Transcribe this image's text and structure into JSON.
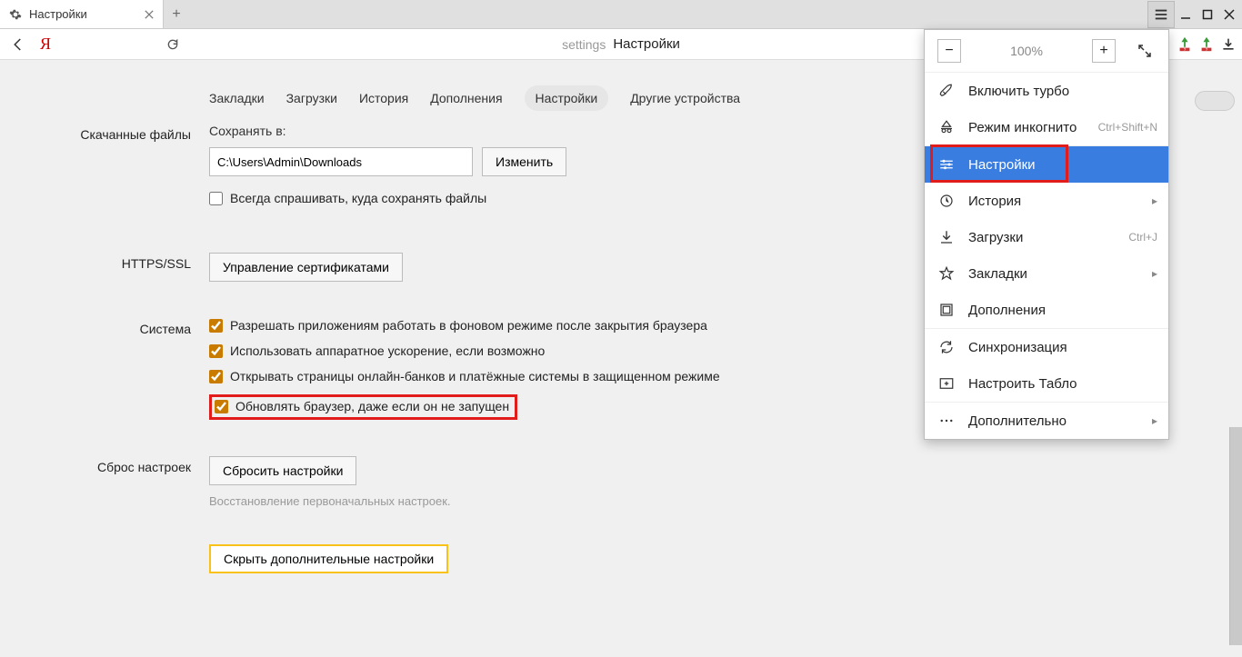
{
  "tab": {
    "title": "Настройки"
  },
  "address": {
    "prefix": "settings",
    "title": "Настройки"
  },
  "pagetabs": [
    "Закладки",
    "Загрузки",
    "История",
    "Дополнения",
    "Настройки",
    "Другие устройства"
  ],
  "active_pagetab_index": 4,
  "downloads": {
    "section": "Скачанные файлы",
    "save_label": "Сохранять в:",
    "path": "C:\\Users\\Admin\\Downloads",
    "change": "Изменить",
    "ask": "Всегда спрашивать, куда сохранять файлы"
  },
  "https": {
    "section": "HTTPS/SSL",
    "button": "Управление сертификатами"
  },
  "system": {
    "section": "Система",
    "items": [
      "Разрешать приложениям работать в фоновом режиме после закрытия браузера",
      "Использовать аппаратное ускорение, если возможно",
      "Открывать страницы онлайн-банков и платёжные системы в защищенном режиме",
      "Обновлять браузер, даже если он не запущен"
    ]
  },
  "reset": {
    "section": "Сброс настроек",
    "button": "Сбросить настройки",
    "hint": "Восстановление первоначальных настроек."
  },
  "hide_button": "Скрыть дополнительные настройки",
  "menu": {
    "zoom": "100%",
    "items": [
      {
        "icon": "rocket",
        "label": "Включить турбо"
      },
      {
        "icon": "incognito",
        "label": "Режим инкогнито",
        "shortcut": "Ctrl+Shift+N"
      },
      {
        "icon": "sliders",
        "label": "Настройки",
        "active": true
      },
      {
        "icon": "history",
        "label": "История",
        "arrow": true
      },
      {
        "icon": "download",
        "label": "Загрузки",
        "shortcut": "Ctrl+J"
      },
      {
        "icon": "star",
        "label": "Закладки",
        "arrow": true
      },
      {
        "icon": "addons",
        "label": "Дополнения"
      },
      {
        "icon": "sync",
        "label": "Синхронизация"
      },
      {
        "icon": "tableau",
        "label": "Настроить Табло"
      },
      {
        "icon": "more",
        "label": "Дополнительно",
        "arrow": true
      }
    ]
  }
}
